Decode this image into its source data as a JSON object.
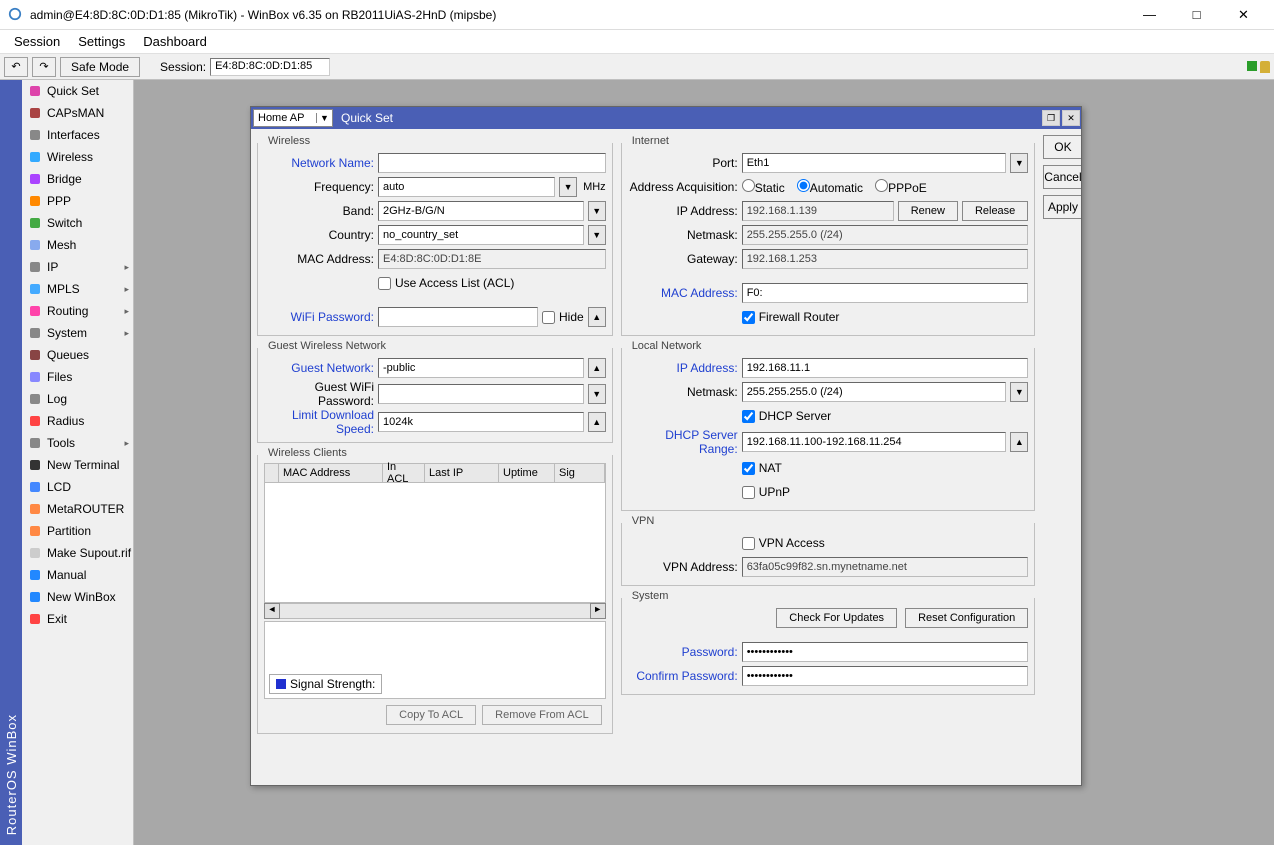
{
  "window": {
    "title": "admin@E4:8D:8C:0D:D1:85 (MikroTik) - WinBox v6.35 on RB2011UiAS-2HnD (mipsbe)"
  },
  "menu": {
    "session": "Session",
    "settings": "Settings",
    "dashboard": "Dashboard"
  },
  "toolbar": {
    "safe_mode": "Safe Mode",
    "session_label": "Session:",
    "session_value": "E4:8D:8C:0D:D1:85"
  },
  "vertical_title": "RouterOS WinBox",
  "sidebar": [
    {
      "label": "Quick Set",
      "arrow": false
    },
    {
      "label": "CAPsMAN",
      "arrow": false
    },
    {
      "label": "Interfaces",
      "arrow": false
    },
    {
      "label": "Wireless",
      "arrow": false
    },
    {
      "label": "Bridge",
      "arrow": false
    },
    {
      "label": "PPP",
      "arrow": false
    },
    {
      "label": "Switch",
      "arrow": false
    },
    {
      "label": "Mesh",
      "arrow": false
    },
    {
      "label": "IP",
      "arrow": true
    },
    {
      "label": "MPLS",
      "arrow": true
    },
    {
      "label": "Routing",
      "arrow": true
    },
    {
      "label": "System",
      "arrow": true
    },
    {
      "label": "Queues",
      "arrow": false
    },
    {
      "label": "Files",
      "arrow": false
    },
    {
      "label": "Log",
      "arrow": false
    },
    {
      "label": "Radius",
      "arrow": false
    },
    {
      "label": "Tools",
      "arrow": true
    },
    {
      "label": "New Terminal",
      "arrow": false
    },
    {
      "label": "LCD",
      "arrow": false
    },
    {
      "label": "MetaROUTER",
      "arrow": false
    },
    {
      "label": "Partition",
      "arrow": false
    },
    {
      "label": "Make Supout.rif",
      "arrow": false
    },
    {
      "label": "Manual",
      "arrow": false
    },
    {
      "label": "New WinBox",
      "arrow": false
    },
    {
      "label": "Exit",
      "arrow": false
    }
  ],
  "qs": {
    "mode": "Home AP",
    "title": "Quick Set",
    "buttons": {
      "ok": "OK",
      "cancel": "Cancel",
      "apply": "Apply"
    },
    "wireless": {
      "legend": "Wireless",
      "network_name_lbl": "Network Name:",
      "network_name": "",
      "frequency_lbl": "Frequency:",
      "frequency": "auto",
      "mhz": "MHz",
      "band_lbl": "Band:",
      "band": "2GHz-B/G/N",
      "country_lbl": "Country:",
      "country": "no_country_set",
      "mac_lbl": "MAC Address:",
      "mac": "E4:8D:8C:0D:D1:8E",
      "acl_lbl": "Use Access List (ACL)",
      "wifi_pw_lbl": "WiFi Password:",
      "wifi_pw": "",
      "hide_lbl": "Hide"
    },
    "guest": {
      "legend": "Guest Wireless Network",
      "net_lbl": "Guest Network:",
      "net": "-public",
      "pw_lbl": "Guest WiFi Password:",
      "pw": "",
      "limit_lbl": "Limit Download Speed:",
      "limit": "1024k"
    },
    "clients": {
      "legend": "Wireless Clients",
      "col_mac": "MAC Address",
      "col_acl": "In ACL",
      "col_lastip": "Last IP",
      "col_uptime": "Uptime",
      "col_sig": "Sig",
      "signal_strength": "Signal Strength:",
      "copy": "Copy To ACL",
      "remove": "Remove From ACL"
    },
    "internet": {
      "legend": "Internet",
      "port_lbl": "Port:",
      "port": "Eth1",
      "acq_lbl": "Address Acquisition:",
      "static": "Static",
      "auto": "Automatic",
      "pppoe": "PPPoE",
      "ip_lbl": "IP Address:",
      "ip": "192.168.1.139",
      "renew": "Renew",
      "release": "Release",
      "mask_lbl": "Netmask:",
      "mask": "255.255.255.0 (/24)",
      "gw_lbl": "Gateway:",
      "gw": "192.168.1.253",
      "mac_lbl": "MAC Address:",
      "mac": "F0:",
      "fw_lbl": "Firewall Router"
    },
    "local": {
      "legend": "Local Network",
      "ip_lbl": "IP Address:",
      "ip": "192.168.11.1",
      "mask_lbl": "Netmask:",
      "mask": "255.255.255.0 (/24)",
      "dhcp_lbl": "DHCP Server",
      "range_lbl": "DHCP Server Range:",
      "range": "192.168.11.100-192.168.11.254",
      "nat_lbl": "NAT",
      "upnp_lbl": "UPnP"
    },
    "vpn": {
      "legend": "VPN",
      "access_lbl": "VPN Access",
      "addr_lbl": "VPN Address:",
      "addr": "63fa05c99f82.sn.mynetname.net"
    },
    "system": {
      "legend": "System",
      "check": "Check For Updates",
      "reset": "Reset Configuration",
      "pw_lbl": "Password:",
      "cpw_lbl": "Confirm Password:"
    }
  }
}
